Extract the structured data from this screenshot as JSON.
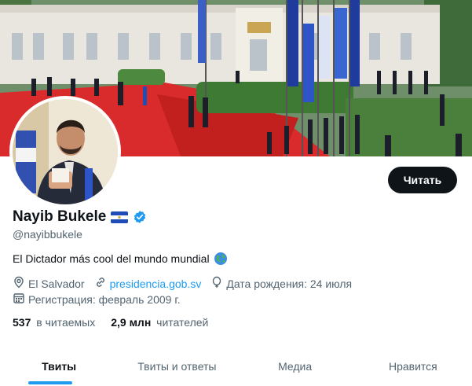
{
  "profile": {
    "name": "Nayib Bukele",
    "handle": "@nayibbukele",
    "bio": "El Dictador más cool del mundo mundial",
    "location": "El Salvador",
    "website": "presidencia.gob.sv",
    "birthday": "Дата рождения: 24 июля",
    "joined": "Регистрация: февраль 2009 г."
  },
  "actions": {
    "follow_label": "Читать"
  },
  "stats": {
    "following_count": "537",
    "following_label": "в читаемых",
    "followers_count": "2,9 млн",
    "followers_label": "читателей"
  },
  "tabs": [
    {
      "label": "Твиты",
      "active": true
    },
    {
      "label": "Твиты и ответы",
      "active": false
    },
    {
      "label": "Медиа",
      "active": false
    },
    {
      "label": "Нравится",
      "active": false
    }
  ],
  "colors": {
    "accent": "#1d9bf0",
    "button_bg": "#0f1419",
    "text_primary": "#0f1419",
    "text_secondary": "#536471"
  },
  "icons": {
    "verified": "verified-badge-icon",
    "flag": "el-salvador-flag-icon",
    "globe": "globe-icon",
    "location": "location-pin-icon",
    "link": "link-icon",
    "birthday": "balloon-icon",
    "joined": "calendar-icon"
  }
}
